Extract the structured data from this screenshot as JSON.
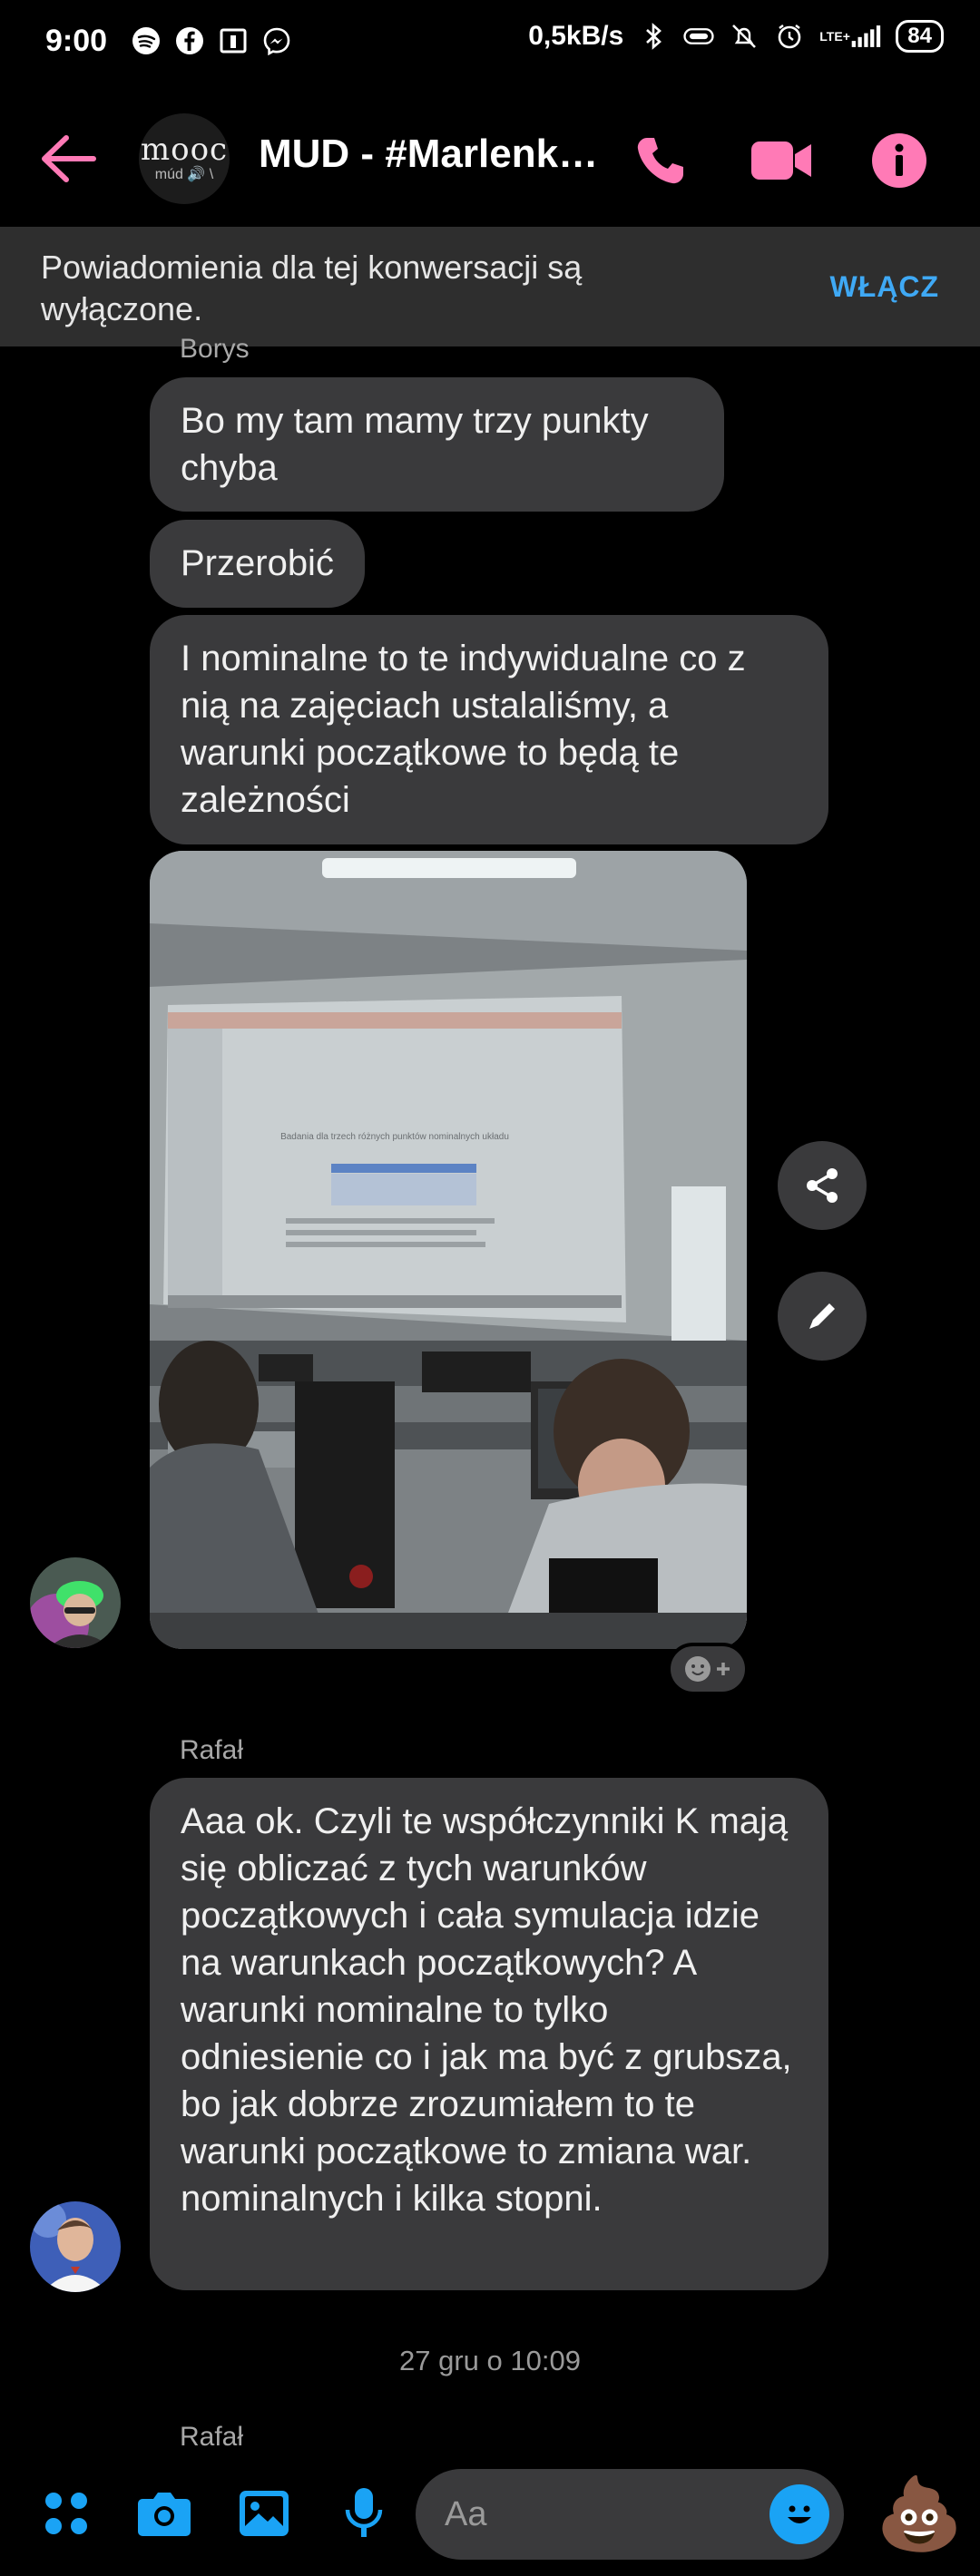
{
  "status_bar": {
    "time": "9:00",
    "network_speed": "0,5kB/s",
    "network_type": "LTE+",
    "battery": "84",
    "icons": [
      "spotify-icon",
      "facebook-icon",
      "app-icon",
      "messenger-icon",
      "vr-icon",
      "bluetooth-icon",
      "dnd-icon",
      "alarm-icon",
      "signal-icon"
    ]
  },
  "header": {
    "title": "MUD - #Marlenka...",
    "avatar_logo": "mooc",
    "avatar_sub": "múd 🔊 \\",
    "accent_color": "#ff7ab6",
    "actions": [
      "phone-icon",
      "video-icon",
      "info-icon"
    ]
  },
  "notification": {
    "text": "Powiadomienia dla tej konwersacji są wyłączone.",
    "action": "WŁĄCZ",
    "action_color": "#3fa9f5"
  },
  "messages": {
    "partial_sender": "Borys",
    "borys": [
      "Bo my tam mamy trzy punkty chyba",
      "Przerobić",
      "I nominalne to te indywidualne co z nią na zajęciach ustalaliśmy, a warunki początkowe to będą te zależności"
    ],
    "photo_title": "Badania dla trzech różnych punktów nominalnych układu",
    "rafal_sender": "Rafał",
    "rafal_text": "Aaa ok. Czyli te współczynniki K mają się obliczać z tych warunków początkowych i cała symulacja idzie na warunkach początkowych? A warunki nominalne to tylko odniesienie co i jak ma być z grubsza, bo jak dobrze zrozumiałem to te warunki początkowe to zmiana war. nominalnych i kilka stopni.",
    "timestamp": "27 gru o 10:09",
    "next_sender": "Rafał"
  },
  "composer": {
    "placeholder": "Aa",
    "icons": [
      "apps-icon",
      "camera-icon",
      "gallery-icon",
      "microphone-icon",
      "emoji-icon"
    ],
    "quick_reaction": "💩"
  }
}
